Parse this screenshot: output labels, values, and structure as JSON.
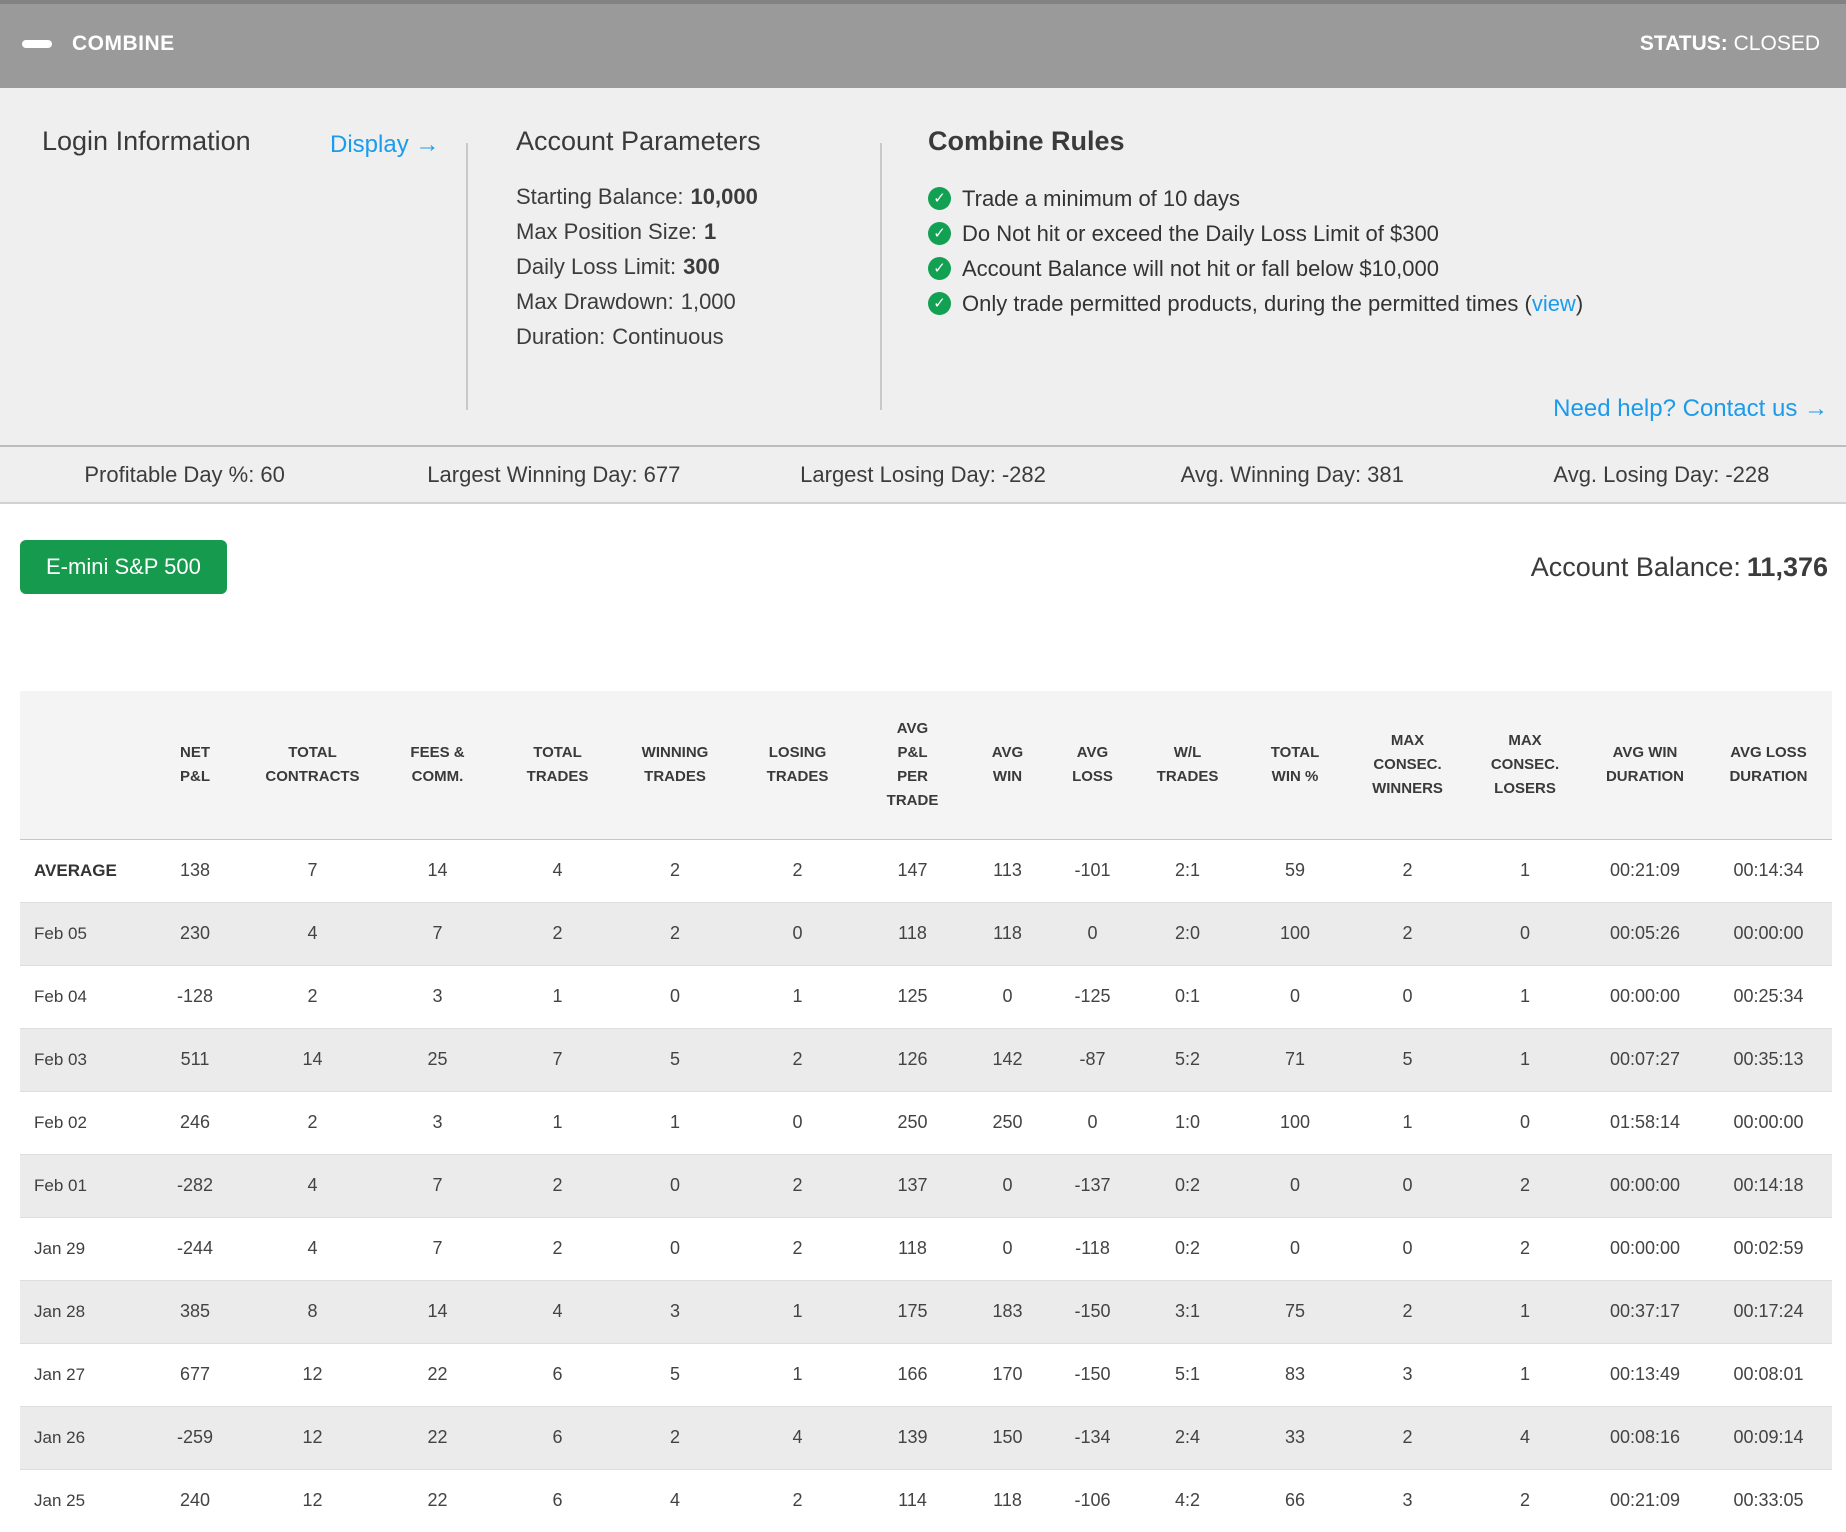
{
  "header": {
    "title": "COMBINE",
    "status_label": "STATUS:",
    "status_value": "CLOSED"
  },
  "icons": {
    "check": "✓",
    "collapse": "minus-bar"
  },
  "login_info": {
    "title": "Login Information",
    "display_link": "Display →"
  },
  "account_parameters": {
    "title": "Account Parameters",
    "params": [
      {
        "label": "Starting Balance:",
        "value": "10,000",
        "bold": true
      },
      {
        "label": "Max Position Size:",
        "value": "1",
        "bold": true
      },
      {
        "label": "Daily Loss Limit:",
        "value": "300",
        "bold": true
      },
      {
        "label": "Max Drawdown:",
        "value": "1,000",
        "bold": false
      },
      {
        "label": "Duration:",
        "value": "Continuous",
        "bold": false
      }
    ]
  },
  "combine_rules": {
    "title": "Combine Rules",
    "rules": [
      {
        "prefix": "Trade a minimum of 10 days",
        "link": "",
        "suffix": ""
      },
      {
        "prefix": "Do Not hit or exceed the Daily Loss Limit of $300",
        "link": "",
        "suffix": ""
      },
      {
        "prefix": "Account Balance will not hit or fall below $10,000",
        "link": "",
        "suffix": ""
      },
      {
        "prefix": "Only trade permitted products, during the permitted times (",
        "link": "view",
        "suffix": ")"
      }
    ],
    "help_link": "Need help? Contact us →"
  },
  "stats": [
    {
      "label": "Profitable Day %:",
      "value": "60"
    },
    {
      "label": "Largest Winning Day:",
      "value": "677"
    },
    {
      "label": "Largest Losing Day:",
      "value": "-282"
    },
    {
      "label": "Avg. Winning Day:",
      "value": "381"
    },
    {
      "label": "Avg. Losing Day:",
      "value": "-228"
    }
  ],
  "product_button_label": "E-mini S&P 500",
  "account_balance": {
    "label": "Account Balance:",
    "value": "11,376"
  },
  "table": {
    "columns": [
      "",
      "NET\nP&L",
      "TOTAL\nCONTRACTS",
      "FEES &\nCOMM.",
      "TOTAL\nTRADES",
      "WINNING\nTRADES",
      "LOSING\nTRADES",
      "AVG\nP&L\nPER\nTRADE",
      "AVG\nWIN",
      "AVG\nLOSS",
      "W/L\nTRADES",
      "TOTAL\nWIN %",
      "MAX\nCONSEC.\nWINNERS",
      "MAX\nCONSEC.\nLOSERS",
      "AVG WIN\nDURATION",
      "AVG LOSS\nDURATION"
    ],
    "rows": [
      {
        "label": "AVERAGE",
        "bold": true,
        "values": [
          "138",
          "7",
          "14",
          "4",
          "2",
          "2",
          "147",
          "113",
          "-101",
          "2:1",
          "59",
          "2",
          "1",
          "00:21:09",
          "00:14:34"
        ]
      },
      {
        "label": "Feb 05",
        "bold": false,
        "values": [
          "230",
          "4",
          "7",
          "2",
          "2",
          "0",
          "118",
          "118",
          "0",
          "2:0",
          "100",
          "2",
          "0",
          "00:05:26",
          "00:00:00"
        ]
      },
      {
        "label": "Feb 04",
        "bold": false,
        "values": [
          "-128",
          "2",
          "3",
          "1",
          "0",
          "1",
          "125",
          "0",
          "-125",
          "0:1",
          "0",
          "0",
          "1",
          "00:00:00",
          "00:25:34"
        ]
      },
      {
        "label": "Feb 03",
        "bold": false,
        "values": [
          "511",
          "14",
          "25",
          "7",
          "5",
          "2",
          "126",
          "142",
          "-87",
          "5:2",
          "71",
          "5",
          "1",
          "00:07:27",
          "00:35:13"
        ]
      },
      {
        "label": "Feb 02",
        "bold": false,
        "values": [
          "246",
          "2",
          "3",
          "1",
          "1",
          "0",
          "250",
          "250",
          "0",
          "1:0",
          "100",
          "1",
          "0",
          "01:58:14",
          "00:00:00"
        ]
      },
      {
        "label": "Feb 01",
        "bold": false,
        "values": [
          "-282",
          "4",
          "7",
          "2",
          "0",
          "2",
          "137",
          "0",
          "-137",
          "0:2",
          "0",
          "0",
          "2",
          "00:00:00",
          "00:14:18"
        ]
      },
      {
        "label": "Jan 29",
        "bold": false,
        "values": [
          "-244",
          "4",
          "7",
          "2",
          "0",
          "2",
          "118",
          "0",
          "-118",
          "0:2",
          "0",
          "0",
          "2",
          "00:00:00",
          "00:02:59"
        ]
      },
      {
        "label": "Jan 28",
        "bold": false,
        "values": [
          "385",
          "8",
          "14",
          "4",
          "3",
          "1",
          "175",
          "183",
          "-150",
          "3:1",
          "75",
          "2",
          "1",
          "00:37:17",
          "00:17:24"
        ]
      },
      {
        "label": "Jan 27",
        "bold": false,
        "values": [
          "677",
          "12",
          "22",
          "6",
          "5",
          "1",
          "166",
          "170",
          "-150",
          "5:1",
          "83",
          "3",
          "1",
          "00:13:49",
          "00:08:01"
        ]
      },
      {
        "label": "Jan 26",
        "bold": false,
        "values": [
          "-259",
          "12",
          "22",
          "6",
          "2",
          "4",
          "139",
          "150",
          "-134",
          "2:4",
          "33",
          "2",
          "4",
          "00:08:16",
          "00:09:14"
        ]
      },
      {
        "label": "Jan 25",
        "bold": false,
        "values": [
          "240",
          "12",
          "22",
          "6",
          "4",
          "2",
          "114",
          "118",
          "-106",
          "4:2",
          "66",
          "3",
          "2",
          "00:21:09",
          "00:33:05"
        ]
      }
    ]
  }
}
